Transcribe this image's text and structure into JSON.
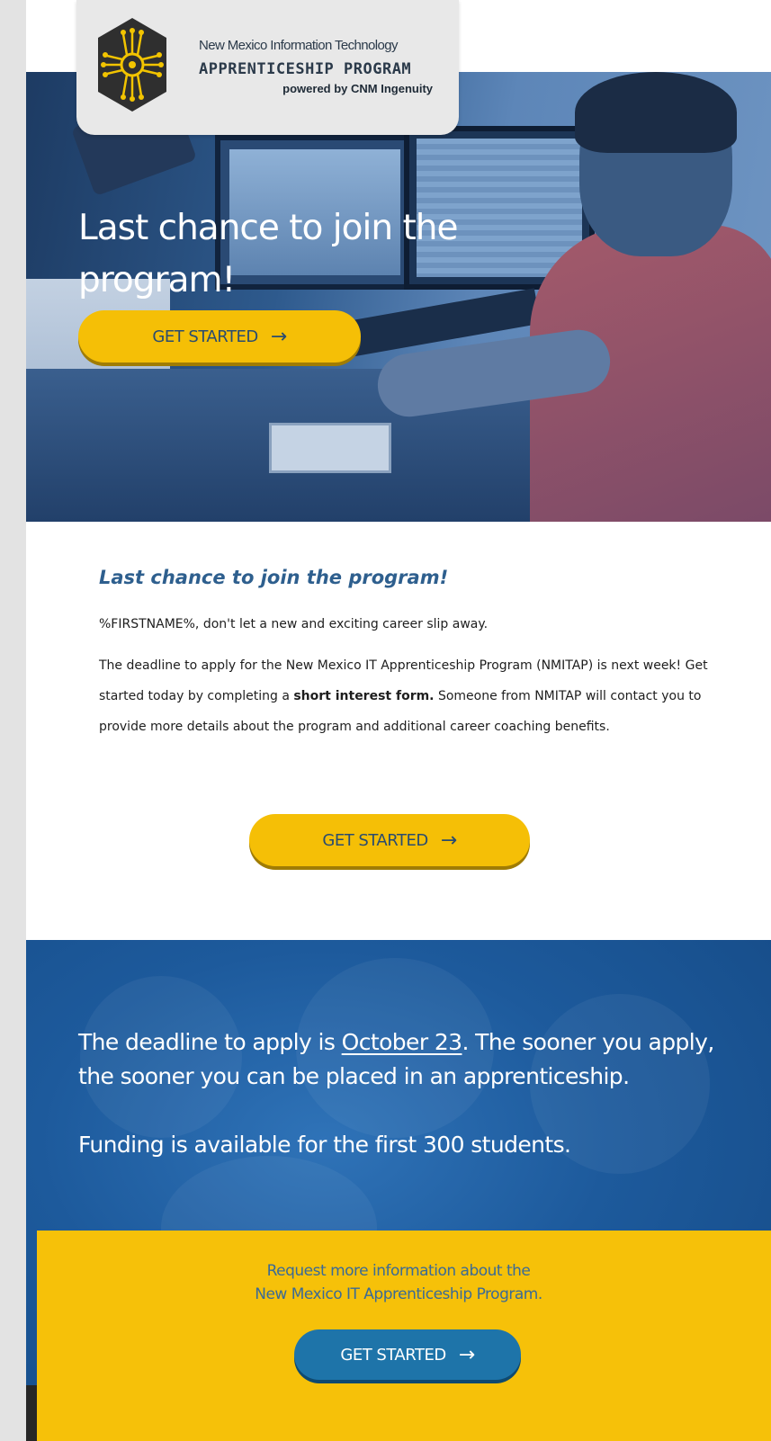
{
  "logo": {
    "line1": "New Mexico Information Technology",
    "line2": "APPRENTICESHIP PROGRAM",
    "line3": "powered by CNM Ingenuity"
  },
  "hero": {
    "title": "Last chance to join the program!",
    "button_label": "GET STARTED",
    "arrow": "→"
  },
  "body": {
    "title": "Last chance to join the program!",
    "greeting": "%FIRSTNAME%, don't let a new and exciting career slip away.",
    "para_before_bold": "The deadline to apply for the New Mexico IT Apprenticeship Program (NMITAP) is next week! Get started today by completing a ",
    "para_bold": "short interest form.",
    "para_after_bold": " Someone from NMITAP will contact you to provide more details about the program and additional career coaching benefits.",
    "button_label": "GET STARTED",
    "arrow": "→"
  },
  "deadline": {
    "text_before": "The deadline to apply is ",
    "date": "October 23",
    "text_after": ". The sooner you apply, the sooner you can be placed in an apprenticeship.",
    "funding": "Funding is available for the first 300 students."
  },
  "cta": {
    "line1": "Request more information about the",
    "line2": "New Mexico IT Apprenticeship Program.",
    "button_label": "GET STARTED",
    "arrow": "→"
  },
  "colors": {
    "accent_yellow": "#f5bf06",
    "brand_blue": "#2e5f8e",
    "button_blue": "#1e74a9"
  }
}
